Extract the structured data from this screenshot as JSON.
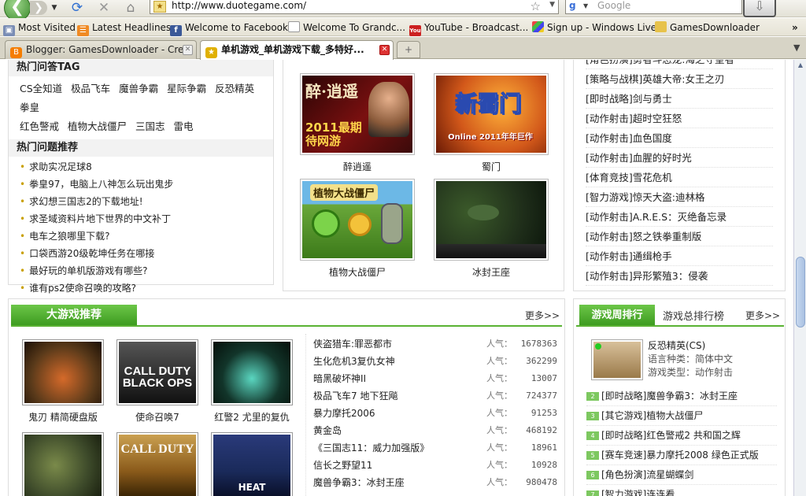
{
  "browser": {
    "url": "http://www.duotegame.com/",
    "search_placeholder": "Google",
    "search_engine_letter": "g",
    "bookmarks": [
      {
        "label": "Most Visited",
        "icon": "bookmark-icon"
      },
      {
        "label": "Latest Headlines",
        "icon": "rss-icon"
      },
      {
        "label": "Welcome to Facebook",
        "icon": "facebook-icon",
        "color": "#3b5998"
      },
      {
        "label": "Welcome To Grandc...",
        "icon": "page-icon"
      },
      {
        "label": "YouTube - Broadcast...",
        "icon": "youtube-icon",
        "color": "#cc2020"
      },
      {
        "label": "Sign up - Windows Live",
        "icon": "windows-icon"
      },
      {
        "label": "GamesDownloader",
        "icon": "folder-icon"
      }
    ],
    "tabs": [
      {
        "label": "Blogger: GamesDownloader - Cre...",
        "active": false,
        "icon": "blogger-icon",
        "color": "#f57d00"
      },
      {
        "label": "单机游戏_单机游戏下载_多特好...",
        "active": true,
        "icon": "site-icon",
        "color": "#e0b000"
      }
    ],
    "new_tab": "+"
  },
  "left_panel": {
    "tag_title": "热门问答TAG",
    "tags": [
      "CS全知道",
      "极品飞车",
      "魔兽争霸",
      "星际争霸",
      "反恐精英",
      "拳皇",
      "红色警戒",
      "植物大战僵尸",
      "三国志",
      "雷电"
    ],
    "questions_title": "热门问题推荐",
    "questions": [
      "求助实况足球8",
      "拳皇97，电脑上八神怎么玩出鬼步",
      "求幻想三国志2的下载地址!",
      "求圣域资料片地下世界的中文补丁",
      "电车之狼哪里下载?",
      "口袋西游20级乾坤任务在哪接",
      "最好玩的单机版游戏有哪些?",
      "谁有ps2使命召唤的攻略?"
    ]
  },
  "middle_panel": {
    "top_captions": [
      "...",
      "..."
    ],
    "games": [
      {
        "name": "醉逍遥",
        "art_text": "2011最期待网游",
        "art_sub": "醉·逍遥",
        "bg": "#7a1010"
      },
      {
        "name": "蜀门",
        "art_text": "新蜀门",
        "art_sub": "Online 2011年年巨作",
        "bg": "#d2581a"
      },
      {
        "name": "植物大战僵尸",
        "art_text": "植物大战僵尸",
        "art_sub": "",
        "bg": "#4f8a2a"
      },
      {
        "name": "冰封王座",
        "art_text": "",
        "art_sub": "",
        "bg": "#1f2e1a"
      }
    ]
  },
  "right_list": {
    "items": [
      "[角色扮演]勇者斗恶龙:海之守望者",
      "[策略与战棋]英雄大帝:女王之刃",
      "[即时战略]剑与勇士",
      "[动作射击]超时空狂怒",
      "[动作射击]血色国度",
      "[动作射击]血腥的好时光",
      "[体育竞技]雪花危机",
      "[智力游戏]惊天大盗:迪林格",
      "[动作射击]A.R.E.S：灭绝备忘录",
      "[动作射击]怒之铁拳重制版",
      "[动作射击]通缉枪手",
      "[动作射击]异形繁殖3：侵袭"
    ]
  },
  "big_games": {
    "title": "大游戏推荐",
    "more": "更多>>",
    "cards": [
      {
        "name": "鬼刃 精简硬盘版",
        "bg": "#5a3a1a"
      },
      {
        "name": "使命召唤7",
        "bg": "#222"
      },
      {
        "name": "红警2 尤里的复仇",
        "bg": "#12352a"
      },
      {
        "name": "",
        "bg": "#3d4a2a"
      },
      {
        "name": "",
        "bg": "#8a5a1a"
      },
      {
        "name": "",
        "bg": "#1a2a5a"
      }
    ],
    "card_art": [
      "",
      "CALL DUTY BLACK OPS",
      "",
      "",
      "CALL DUTY",
      "HEAT"
    ],
    "popularity_label": "人气：",
    "list": [
      {
        "name": "侠盗猎车:罪恶都市",
        "pop": "1678363"
      },
      {
        "name": "生化危机3复仇女神",
        "pop": "362299"
      },
      {
        "name": "暗黑破坏神II",
        "pop": "13007"
      },
      {
        "name": "极品飞车7 地下狂飚",
        "pop": "724377"
      },
      {
        "name": "暴力摩托2006",
        "pop": "91253"
      },
      {
        "name": "黄金岛",
        "pop": "468192"
      },
      {
        "name": "《三国志11：威力加强版》",
        "pop": "18961"
      },
      {
        "name": "信长之野望11",
        "pop": "10928"
      },
      {
        "name": "魔兽争霸3：冰封王座",
        "pop": "980478"
      },
      {
        "name": "...",
        "pop": ""
      }
    ]
  },
  "weekly_rank": {
    "tab_active": "游戏周排行",
    "tab_other": "游戏总排行榜",
    "more": "更多>>",
    "featured": {
      "name": "反恐精英(CS)",
      "lang": "语言种类：简体中文",
      "type": "游戏类型：动作射击"
    },
    "items": [
      {
        "n": "2",
        "name": "[即时战略]魔兽争霸3：冰封王座"
      },
      {
        "n": "3",
        "name": "[其它游戏]植物大战僵尸"
      },
      {
        "n": "4",
        "name": "[即时战略]红色警戒2 共和国之辉"
      },
      {
        "n": "5",
        "name": "[赛车竞速]暴力摩托2008 绿色正式版"
      },
      {
        "n": "6",
        "name": "[角色扮演]流星蝴蝶剑"
      },
      {
        "n": "7",
        "name": "[智力游戏]连连看"
      }
    ]
  }
}
